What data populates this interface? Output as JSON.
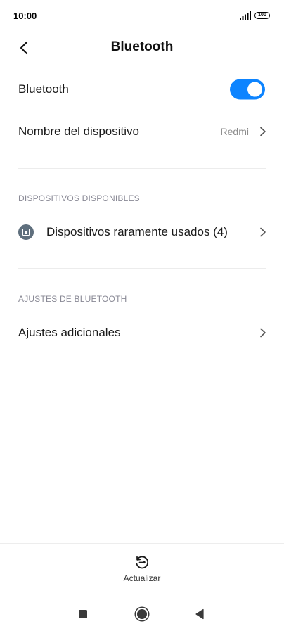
{
  "status_bar": {
    "time": "10:00",
    "battery": "100"
  },
  "header": {
    "title": "Bluetooth"
  },
  "bluetooth_row": {
    "label": "Bluetooth",
    "enabled": true
  },
  "device_name_row": {
    "label": "Nombre del dispositivo",
    "value": "Redmi"
  },
  "available_section": {
    "header": "DISPOSITIVOS DISPONIBLES",
    "items": [
      {
        "label": "Dispositivos raramente usados (4)"
      }
    ]
  },
  "settings_section": {
    "header": "AJUSTES DE BLUETOOTH",
    "items": [
      {
        "label": "Ajustes adicionales"
      }
    ]
  },
  "bottom_action": {
    "label": "Actualizar",
    "icon": "refresh-icon"
  },
  "colors": {
    "accent": "#0d84ff",
    "section_header": "#8a8a96",
    "secondary_text": "#8c8c8c",
    "device_icon_bg": "#5f6f7d"
  }
}
